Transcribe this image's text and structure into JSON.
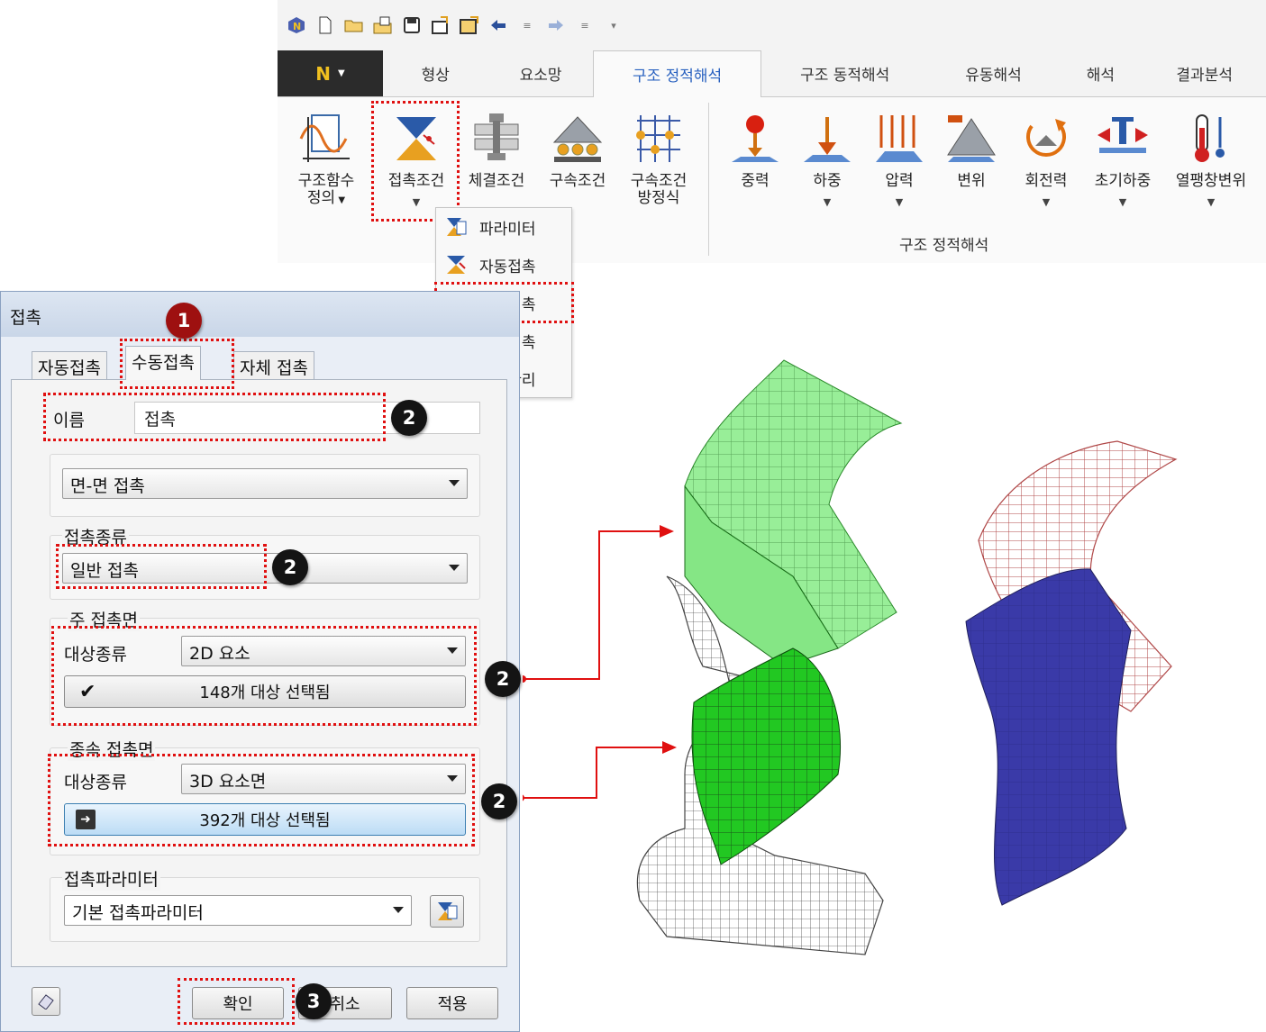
{
  "ribbon": {
    "tabs": [
      "형상",
      "요소망",
      "구조 정적해석",
      "구조 동적해석",
      "유동해석",
      "해석",
      "결과분석"
    ],
    "active_tab": "구조 정적해석",
    "buttons_left": [
      {
        "label1": "구조함수",
        "label2": "정의",
        "icon": "function-graph-icon"
      },
      {
        "label1": "접촉조건",
        "label2": "",
        "icon": "contact-condition-icon"
      },
      {
        "label1": "체결조건",
        "label2": "",
        "icon": "fastening-icon"
      },
      {
        "label1": "구속조건",
        "label2": "",
        "icon": "constraint-icon"
      },
      {
        "label1": "구속조건",
        "label2": "방정식",
        "icon": "constraint-equation-icon"
      }
    ],
    "buttons_right": [
      {
        "label": "중력",
        "icon": "gravity-icon"
      },
      {
        "label": "하중",
        "icon": "load-icon"
      },
      {
        "label": "압력",
        "icon": "pressure-icon"
      },
      {
        "label": "변위",
        "icon": "displacement-icon"
      },
      {
        "label": "회전력",
        "icon": "rotational-force-icon"
      },
      {
        "label": "초기하중",
        "icon": "initial-load-icon"
      },
      {
        "label": "열팽창변위",
        "icon": "thermal-expansion-icon"
      }
    ],
    "group_label": "구조 정적해석",
    "dropdown_items": [
      "파라미터",
      "자동접촉",
      "수동접촉",
      "자체접촉",
      "접촉관리"
    ],
    "highlighted_item": "수동접촉"
  },
  "dialog": {
    "title": "접촉",
    "tabs": [
      "자동접촉",
      "수동접촉",
      "자체 접촉"
    ],
    "active_tab": "수동접촉",
    "name_label": "이름",
    "name_value": "접촉",
    "contact_mode": "면-면 접촉",
    "contact_type_legend": "접촉종류",
    "contact_type_value": "일반 접촉",
    "master_legend": "주 접촉면",
    "master_target_label": "대상종류",
    "master_target_value": "2D 요소",
    "master_selection": "148개 대상 선택됨",
    "slave_legend": "종속 접촉면",
    "slave_target_label": "대상종류",
    "slave_target_value": "3D 요소면",
    "slave_selection": "392개 대상 선택됨",
    "param_legend": "접촉파라미터",
    "param_value": "기본 접촉파라미터",
    "ok_label": "확인",
    "cancel_label": "취소",
    "apply_label": "적용"
  },
  "badges": {
    "step1": "1",
    "step2": "2",
    "step3": "3"
  },
  "colors": {
    "accent": "#2a62c0",
    "highlight": "#e01010",
    "mesh_green": "#33d633",
    "mesh_red": "#b04848",
    "mesh_blue": "#3a3aa8"
  }
}
